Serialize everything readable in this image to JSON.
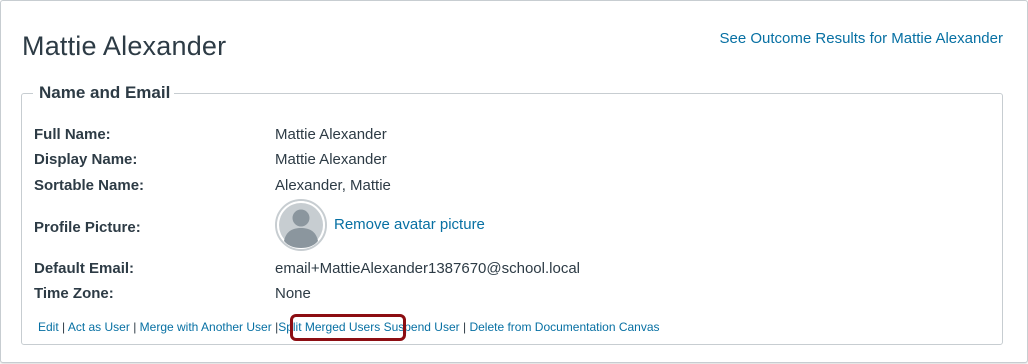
{
  "header": {
    "user_name": "Mattie Alexander",
    "outcome_link": "See Outcome Results for Mattie Alexander"
  },
  "section": {
    "legend": "Name and Email",
    "fields": {
      "full_name": {
        "label": "Full Name:",
        "value": "Mattie Alexander"
      },
      "display_name": {
        "label": "Display Name:",
        "value": "Mattie Alexander"
      },
      "sortable_name": {
        "label": "Sortable Name:",
        "value": "Alexander, Mattie"
      },
      "profile_picture": {
        "label": "Profile Picture:",
        "action": "Remove avatar picture"
      },
      "default_email": {
        "label": "Default Email:",
        "value": "email+MattieAlexander1387670@school.local"
      },
      "time_zone": {
        "label": "Time Zone:",
        "value": "None"
      }
    }
  },
  "actions": {
    "edit": "Edit",
    "act_as_user": "Act as User",
    "merge": "Merge with Another User",
    "split": "Split Merged Users",
    "suspend": "Suspend User",
    "delete": "Delete from Documentation Canvas",
    "separator": "|"
  },
  "icons": {
    "avatar": "default-avatar-icon"
  },
  "colors": {
    "link": "#0770a3",
    "text": "#2d3b45",
    "border": "#c7cdd1",
    "highlight": "#8c0d12"
  }
}
